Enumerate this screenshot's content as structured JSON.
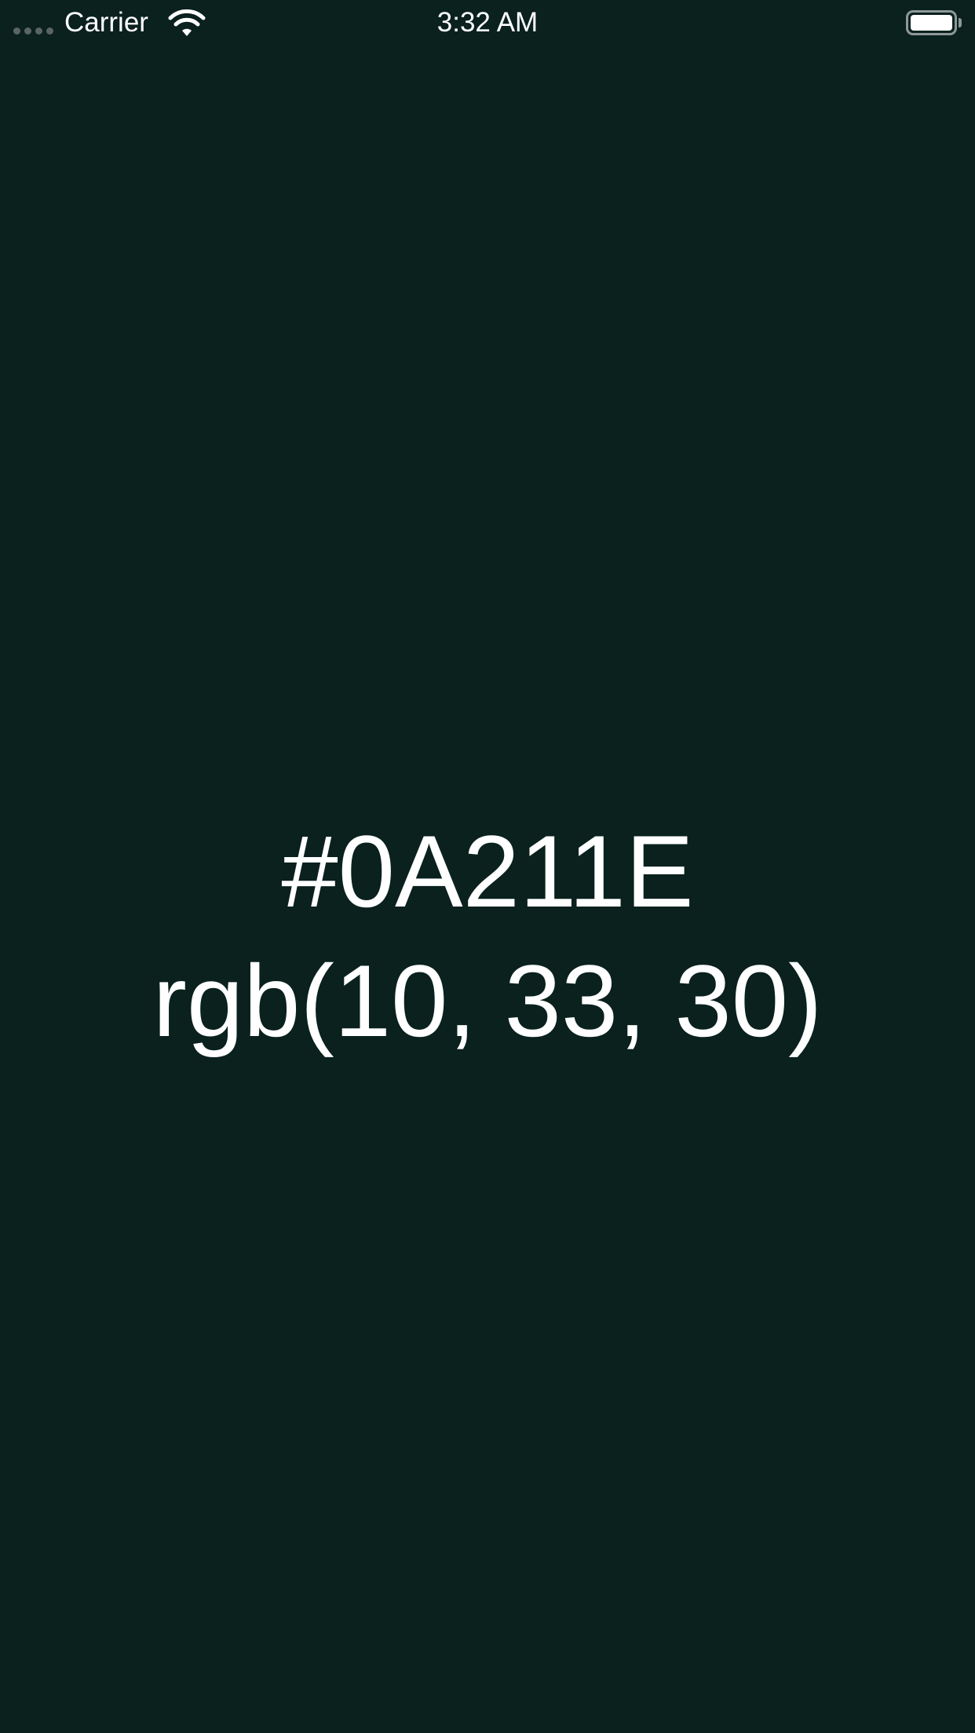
{
  "status_bar": {
    "carrier": "Carrier",
    "time": "3:32 AM",
    "signal_icon": "signal-dots-icon",
    "wifi_icon": "wifi-icon",
    "battery_icon": "battery-full-icon",
    "battery_level": 1.0
  },
  "color": {
    "hex": "#0A211E",
    "rgb": "rgb(10, 33, 30)",
    "background": "#0A211E",
    "text_color": "#FFFFFF"
  }
}
